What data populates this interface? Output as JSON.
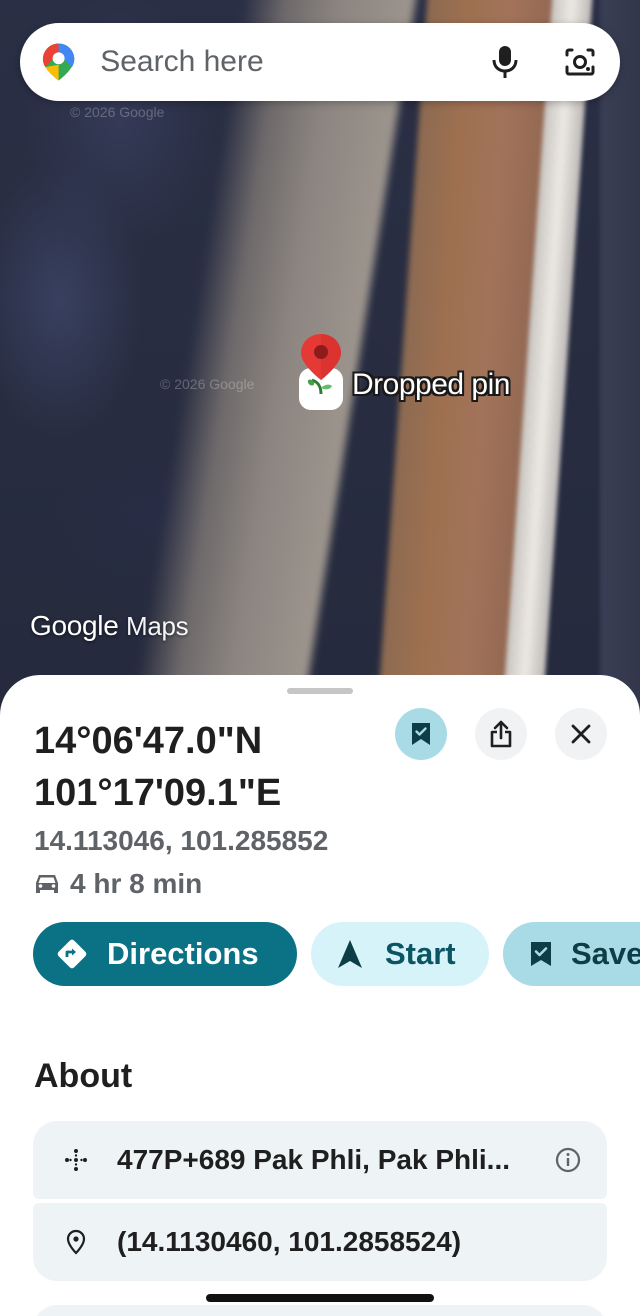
{
  "search": {
    "placeholder": "Search here"
  },
  "map": {
    "watermark_google": "Google",
    "watermark_maps": "Maps",
    "copyright_1": "© 2026 Google",
    "copyright_2": "© 2026 Google"
  },
  "pin": {
    "label": "Dropped pin"
  },
  "place": {
    "dms_line1": "14°06'47.0\"N",
    "dms_line2": "101°17'09.1\"E",
    "decimal": "14.113046, 101.285852",
    "drive_time": "4 hr 8 min"
  },
  "actions": {
    "directions": "Directions",
    "start": "Start",
    "save": "Save"
  },
  "about": {
    "title": "About",
    "plus_code": "477P+689 Pak Phli, Pak Phli...",
    "latlng": "(14.1130460, 101.2858524)"
  },
  "colors": {
    "primary_teal": "#0b7285",
    "start_chip_bg": "#d6f3fa",
    "save_chip_bg": "#a8dbe6",
    "pin_red": "#e53935"
  }
}
